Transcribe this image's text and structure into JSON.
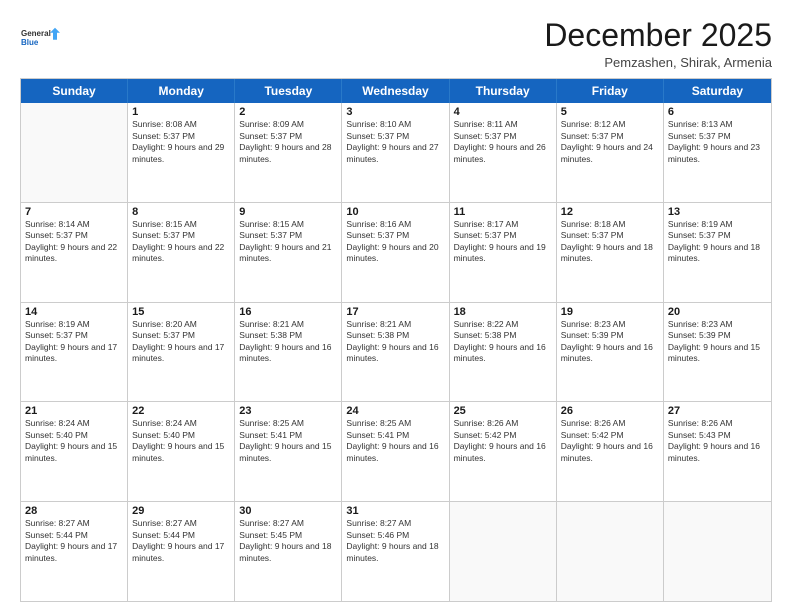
{
  "header": {
    "logo_line1": "General",
    "logo_line2": "Blue",
    "month_title": "December 2025",
    "location": "Pemzashen, Shirak, Armenia"
  },
  "weekdays": [
    "Sunday",
    "Monday",
    "Tuesday",
    "Wednesday",
    "Thursday",
    "Friday",
    "Saturday"
  ],
  "weeks": [
    [
      {
        "day": "",
        "empty": true
      },
      {
        "day": "1",
        "rise": "8:08 AM",
        "set": "5:37 PM",
        "daylight": "9 hours and 29 minutes."
      },
      {
        "day": "2",
        "rise": "8:09 AM",
        "set": "5:37 PM",
        "daylight": "9 hours and 28 minutes."
      },
      {
        "day": "3",
        "rise": "8:10 AM",
        "set": "5:37 PM",
        "daylight": "9 hours and 27 minutes."
      },
      {
        "day": "4",
        "rise": "8:11 AM",
        "set": "5:37 PM",
        "daylight": "9 hours and 26 minutes."
      },
      {
        "day": "5",
        "rise": "8:12 AM",
        "set": "5:37 PM",
        "daylight": "9 hours and 24 minutes."
      },
      {
        "day": "6",
        "rise": "8:13 AM",
        "set": "5:37 PM",
        "daylight": "9 hours and 23 minutes."
      }
    ],
    [
      {
        "day": "7",
        "rise": "8:14 AM",
        "set": "5:37 PM",
        "daylight": "9 hours and 22 minutes."
      },
      {
        "day": "8",
        "rise": "8:15 AM",
        "set": "5:37 PM",
        "daylight": "9 hours and 22 minutes."
      },
      {
        "day": "9",
        "rise": "8:15 AM",
        "set": "5:37 PM",
        "daylight": "9 hours and 21 minutes."
      },
      {
        "day": "10",
        "rise": "8:16 AM",
        "set": "5:37 PM",
        "daylight": "9 hours and 20 minutes."
      },
      {
        "day": "11",
        "rise": "8:17 AM",
        "set": "5:37 PM",
        "daylight": "9 hours and 19 minutes."
      },
      {
        "day": "12",
        "rise": "8:18 AM",
        "set": "5:37 PM",
        "daylight": "9 hours and 18 minutes."
      },
      {
        "day": "13",
        "rise": "8:19 AM",
        "set": "5:37 PM",
        "daylight": "9 hours and 18 minutes."
      }
    ],
    [
      {
        "day": "14",
        "rise": "8:19 AM",
        "set": "5:37 PM",
        "daylight": "9 hours and 17 minutes."
      },
      {
        "day": "15",
        "rise": "8:20 AM",
        "set": "5:37 PM",
        "daylight": "9 hours and 17 minutes."
      },
      {
        "day": "16",
        "rise": "8:21 AM",
        "set": "5:38 PM",
        "daylight": "9 hours and 16 minutes."
      },
      {
        "day": "17",
        "rise": "8:21 AM",
        "set": "5:38 PM",
        "daylight": "9 hours and 16 minutes."
      },
      {
        "day": "18",
        "rise": "8:22 AM",
        "set": "5:38 PM",
        "daylight": "9 hours and 16 minutes."
      },
      {
        "day": "19",
        "rise": "8:23 AM",
        "set": "5:39 PM",
        "daylight": "9 hours and 16 minutes."
      },
      {
        "day": "20",
        "rise": "8:23 AM",
        "set": "5:39 PM",
        "daylight": "9 hours and 15 minutes."
      }
    ],
    [
      {
        "day": "21",
        "rise": "8:24 AM",
        "set": "5:40 PM",
        "daylight": "9 hours and 15 minutes."
      },
      {
        "day": "22",
        "rise": "8:24 AM",
        "set": "5:40 PM",
        "daylight": "9 hours and 15 minutes."
      },
      {
        "day": "23",
        "rise": "8:25 AM",
        "set": "5:41 PM",
        "daylight": "9 hours and 15 minutes."
      },
      {
        "day": "24",
        "rise": "8:25 AM",
        "set": "5:41 PM",
        "daylight": "9 hours and 16 minutes."
      },
      {
        "day": "25",
        "rise": "8:26 AM",
        "set": "5:42 PM",
        "daylight": "9 hours and 16 minutes."
      },
      {
        "day": "26",
        "rise": "8:26 AM",
        "set": "5:42 PM",
        "daylight": "9 hours and 16 minutes."
      },
      {
        "day": "27",
        "rise": "8:26 AM",
        "set": "5:43 PM",
        "daylight": "9 hours and 16 minutes."
      }
    ],
    [
      {
        "day": "28",
        "rise": "8:27 AM",
        "set": "5:44 PM",
        "daylight": "9 hours and 17 minutes."
      },
      {
        "day": "29",
        "rise": "8:27 AM",
        "set": "5:44 PM",
        "daylight": "9 hours and 17 minutes."
      },
      {
        "day": "30",
        "rise": "8:27 AM",
        "set": "5:45 PM",
        "daylight": "9 hours and 18 minutes."
      },
      {
        "day": "31",
        "rise": "8:27 AM",
        "set": "5:46 PM",
        "daylight": "9 hours and 18 minutes."
      },
      {
        "day": "",
        "empty": true
      },
      {
        "day": "",
        "empty": true
      },
      {
        "day": "",
        "empty": true
      }
    ]
  ],
  "labels": {
    "sunrise": "Sunrise:",
    "sunset": "Sunset:",
    "daylight": "Daylight:"
  }
}
